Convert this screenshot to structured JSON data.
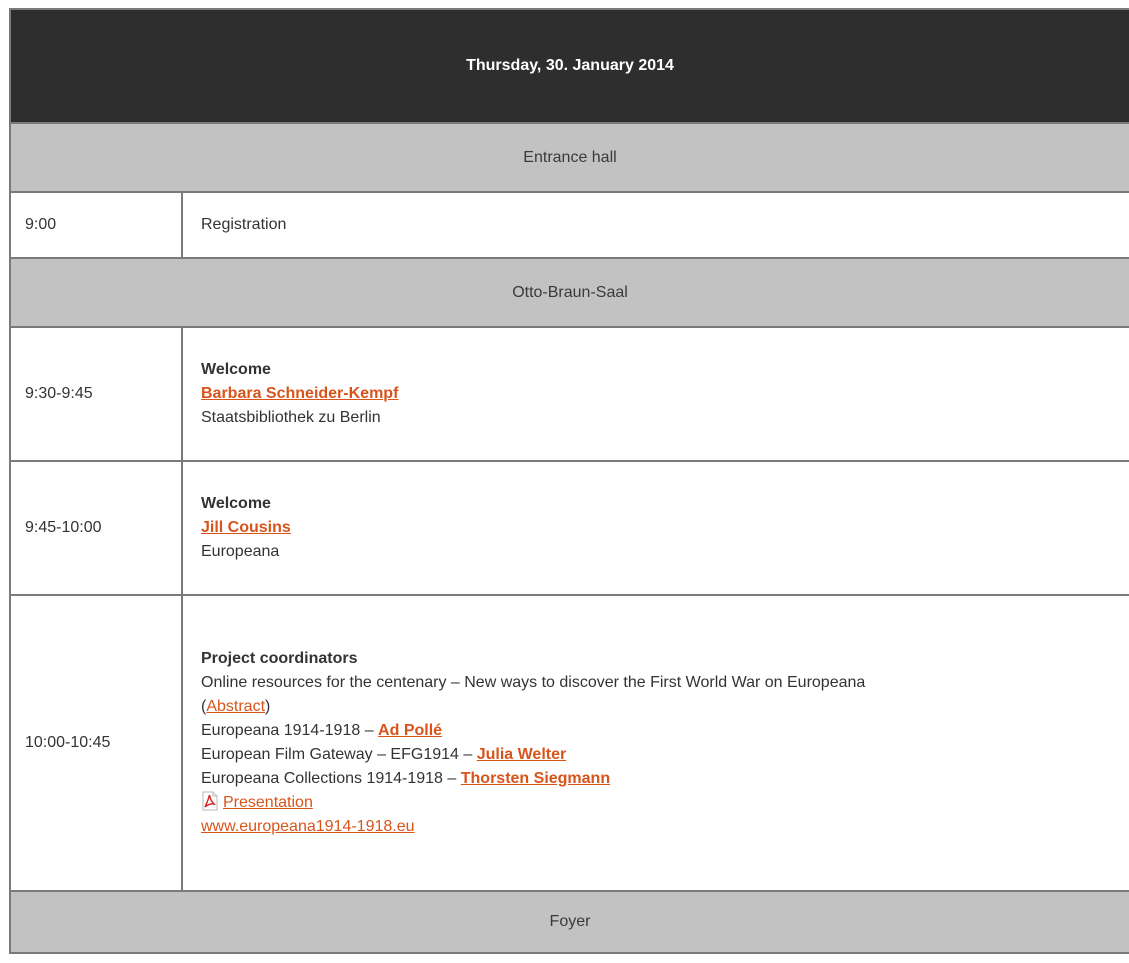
{
  "day_header": "Thursday, 30. January 2014",
  "rooms": {
    "entrance": "Entrance hall",
    "otto": "Otto-Braun-Saal",
    "foyer": "Foyer"
  },
  "sessions": [
    {
      "time": "9:00",
      "text": "Registration"
    },
    {
      "time": "9:30-9:45",
      "title": "Welcome",
      "speaker": "Barbara Schneider-Kempf",
      "org": "Staatsbibliothek zu Berlin"
    },
    {
      "time": "9:45-10:00",
      "title": "Welcome",
      "speaker": "Jill Cousins",
      "org": "Europeana"
    },
    {
      "time": "10:00-10:45",
      "title": "Project coordinators",
      "description": "Online resources for the centenary – New ways to discover the First World War on Europeana",
      "abstract_open": "(",
      "abstract_link": "Abstract",
      "abstract_close": ")",
      "items": [
        {
          "text": "Europeana 1914-1918 – ",
          "speaker": "Ad Pollé"
        },
        {
          "text": "European Film Gateway – EFG1914 – ",
          "speaker": "Julia Welter"
        },
        {
          "text": "Europeana Collections 1914-1918 – ",
          "speaker": "Thorsten Siegmann"
        }
      ],
      "presentation_link": "Presentation",
      "website_link": "www.europeana1914-1918.eu"
    }
  ],
  "colors": {
    "header_bg": "#2e2e2e",
    "room_bg": "#c2c2c2",
    "link": "#d9541b",
    "border": "#7a7a7a"
  },
  "icons": {
    "presentation": "pdf-icon"
  }
}
